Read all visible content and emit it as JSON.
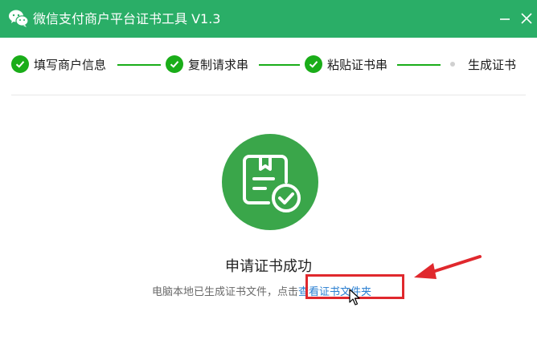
{
  "window": {
    "title": "微信支付商户平台证书工具 V1.3",
    "brand_color": "#2aae67"
  },
  "steps": [
    {
      "label": "填写商户信息",
      "status": "done"
    },
    {
      "label": "复制请求串",
      "status": "done"
    },
    {
      "label": "粘贴证书串",
      "status": "done"
    },
    {
      "label": "生成证书",
      "status": "current"
    }
  ],
  "result": {
    "title": "申请证书成功",
    "description": "电脑本地已生成证书文件，点击",
    "link_label": "查看证书文件夹",
    "icon": "certificate-check-icon"
  },
  "colors": {
    "success": "#1aad19",
    "link": "#2a7fd1",
    "annotation": "#e0282d"
  }
}
